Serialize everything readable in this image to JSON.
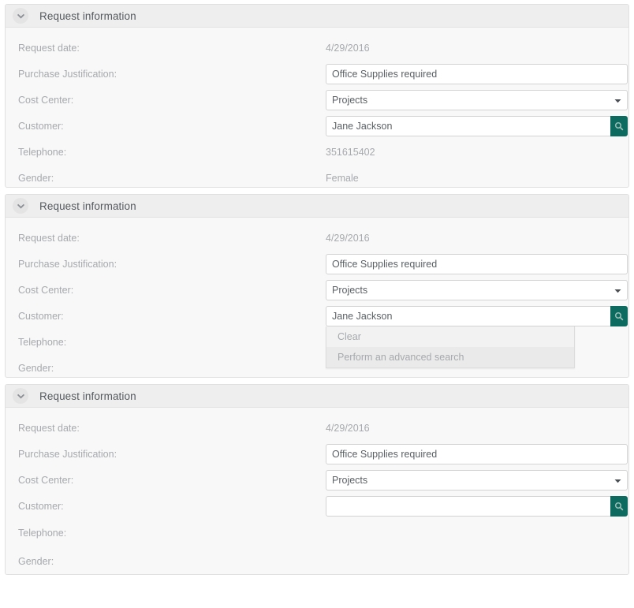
{
  "theme": {
    "accent": "#0c6b5e",
    "panel_bg": "#f8f8f8",
    "panel_header_bg": "#eeeeee",
    "label_color": "#a6a9ad",
    "value_color": "#5b6165",
    "border_color": "#e0e0e0",
    "suggest_bg": "#eaeaea"
  },
  "icons": {
    "collapse": "chevron-down-icon",
    "search": "search-icon",
    "select": "caret-down-icon"
  },
  "labels": {
    "request_date": "Request date:",
    "purchase_justification": "Purchase Justification:",
    "cost_center": "Cost Center:",
    "customer": "Customer:",
    "telephone": "Telephone:",
    "gender": "Gender:"
  },
  "panels": [
    {
      "title": "Request information",
      "request_date": "4/29/2016",
      "purchase_justification": "Office Supplies required",
      "purchase_justification_placeholder": "",
      "cost_center": "Projects",
      "customer": "Jane Jackson",
      "customer_placeholder": "",
      "telephone": "351615402",
      "gender": "Female",
      "suggest_open": false
    },
    {
      "title": "Request information",
      "request_date": "4/29/2016",
      "purchase_justification": "Office Supplies required",
      "purchase_justification_placeholder": "",
      "cost_center": "Projects",
      "customer": "Jane Jackson",
      "customer_placeholder": "",
      "telephone": "",
      "gender": "",
      "suggest_open": true,
      "suggestions": [
        {
          "label": "Clear",
          "highlight": true
        },
        {
          "label": "Perform an advanced search",
          "highlight": false
        }
      ]
    },
    {
      "title": "Request information",
      "request_date": "4/29/2016",
      "purchase_justification": "Office Supplies required",
      "purchase_justification_placeholder": "",
      "cost_center": "Projects",
      "customer": "",
      "customer_placeholder": "",
      "telephone": "",
      "gender": "",
      "suggest_open": false
    }
  ]
}
